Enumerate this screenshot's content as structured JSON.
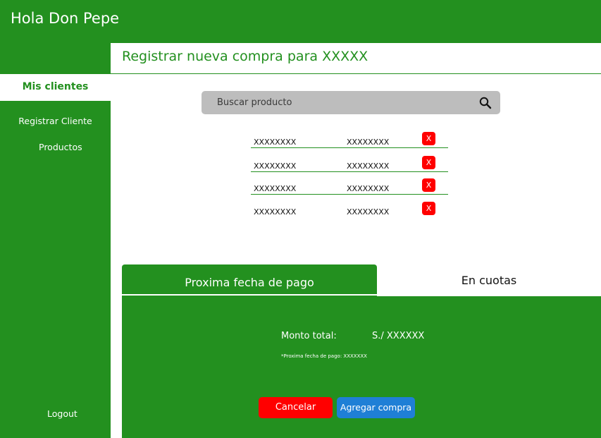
{
  "app": {
    "title": "Hola Don Pepe"
  },
  "sidebar": {
    "active_item": "Mis clientes",
    "items": [
      {
        "label": "Registrar Cliente"
      },
      {
        "label": "Productos"
      }
    ],
    "logout_label": "Logout"
  },
  "main": {
    "title": "Registrar nueva compra para XXXXX",
    "search": {
      "placeholder": "Buscar producto",
      "value": ""
    },
    "products": [
      {
        "name": "XXXXXXXX",
        "price": "XXXXXXXX",
        "delete_label": "X"
      },
      {
        "name": "XXXXXXXX",
        "price": "XXXXXXXX",
        "delete_label": "X"
      },
      {
        "name": "XXXXXXXX",
        "price": "XXXXXXXX",
        "delete_label": "X"
      },
      {
        "name": "XXXXXXXX",
        "price": "XXXXXXXX",
        "delete_label": "X"
      }
    ],
    "tabs": [
      {
        "label": "Proxima fecha de pago",
        "active": true
      },
      {
        "label": "En cuotas",
        "active": false
      }
    ],
    "panel": {
      "monto_label": "Monto total:",
      "monto_value": "S./ XXXXXX",
      "next_payment": "*Proxima fecha de pago: XXXXXXX",
      "cancel_label": "Cancelar",
      "add_label": "Agregar compra"
    }
  },
  "colors": {
    "brand_green": "#23901f",
    "danger_red": "#ff0000",
    "primary_blue": "#1f7fd6",
    "search_gray": "#bdbdbd"
  },
  "icons": {
    "search": "search-icon",
    "delete": "close-icon"
  }
}
